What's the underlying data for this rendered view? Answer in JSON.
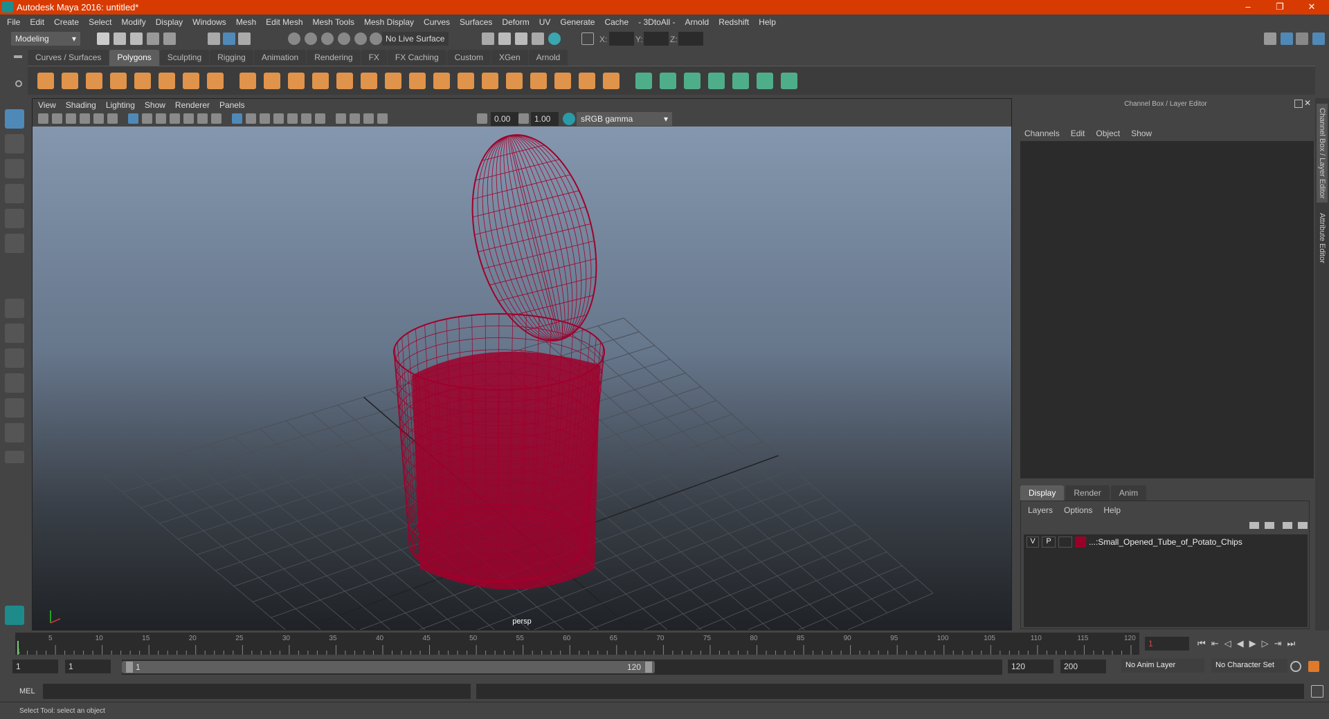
{
  "window": {
    "title": "Autodesk Maya 2016: untitled*",
    "minimize": "–",
    "restore": "❐",
    "close": "✕"
  },
  "menu": [
    "File",
    "Edit",
    "Create",
    "Select",
    "Modify",
    "Display",
    "Windows",
    "Mesh",
    "Edit Mesh",
    "Mesh Tools",
    "Mesh Display",
    "Curves",
    "Surfaces",
    "Deform",
    "UV",
    "Generate",
    "Cache",
    "- 3DtoAll -",
    "Arnold",
    "Redshift",
    "Help"
  ],
  "statusline": {
    "mode": "Modeling",
    "live_surface": "No Live Surface",
    "x_label": "X:",
    "y_label": "Y:",
    "z_label": "Z:",
    "x": "",
    "y": "",
    "z": ""
  },
  "shelf": {
    "tabs": [
      "Curves / Surfaces",
      "Polygons",
      "Sculpting",
      "Rigging",
      "Animation",
      "Rendering",
      "FX",
      "FX Caching",
      "Custom",
      "XGen",
      "Arnold"
    ],
    "active": "Polygons",
    "icons": [
      "sphere",
      "cube",
      "cylinder",
      "cone",
      "plane",
      "torus",
      "pyramid",
      "pipe",
      "combine",
      "separate",
      "mirror",
      "smooth",
      "extrude",
      "bridge",
      "append",
      "multi-cut",
      "bevel",
      "bridge-edge",
      "merge",
      "fill-hole",
      "target-weld",
      "insert-edge-loop",
      "offset-edge-loop",
      "poke",
      "boolean",
      "planar-uv",
      "cylindrical-uv",
      "spherical-uv",
      "automatic-uv",
      "uv-editor",
      "unfold-uv"
    ],
    "orange": "#e0934a",
    "green": "#4fae8a"
  },
  "viewport": {
    "menu": [
      "View",
      "Shading",
      "Lighting",
      "Show",
      "Renderer",
      "Panels"
    ],
    "exposure": "0.00",
    "gamma": "1.00",
    "color_space": "sRGB gamma",
    "camera": "persp",
    "mesh_color": "#a0002b"
  },
  "channel_box": {
    "title": "Channel Box / Layer Editor",
    "menu": [
      "Channels",
      "Edit",
      "Object",
      "Show"
    ]
  },
  "layer_editor": {
    "tabs": [
      "Display",
      "Render",
      "Anim"
    ],
    "active": "Display",
    "menu": [
      "Layers",
      "Options",
      "Help"
    ],
    "layers": [
      {
        "v": "V",
        "p": "P",
        "color": "#9a0028",
        "name": "...:Small_Opened_Tube_of_Potato_Chips"
      }
    ]
  },
  "side_tabs": [
    "Channel Box / Layer Editor",
    "Attribute Editor"
  ],
  "timeline": {
    "start": 1,
    "end": 120,
    "labels": [
      5,
      10,
      15,
      20,
      25,
      30,
      35,
      40,
      45,
      50,
      55,
      60,
      65,
      70,
      75,
      80,
      85,
      90,
      95,
      100,
      105,
      110,
      115,
      120
    ],
    "current": "1",
    "current_frame": "1"
  },
  "range": {
    "start": "1",
    "playback_start": "1",
    "slider_start": "1",
    "slider_end": "120",
    "playback_end": "120",
    "end": "200",
    "anim_layer": "No Anim Layer",
    "character_set": "No Character Set"
  },
  "mel": {
    "label": "MEL",
    "input": "",
    "output": ""
  },
  "status": {
    "message": "Select Tool: select an object"
  }
}
